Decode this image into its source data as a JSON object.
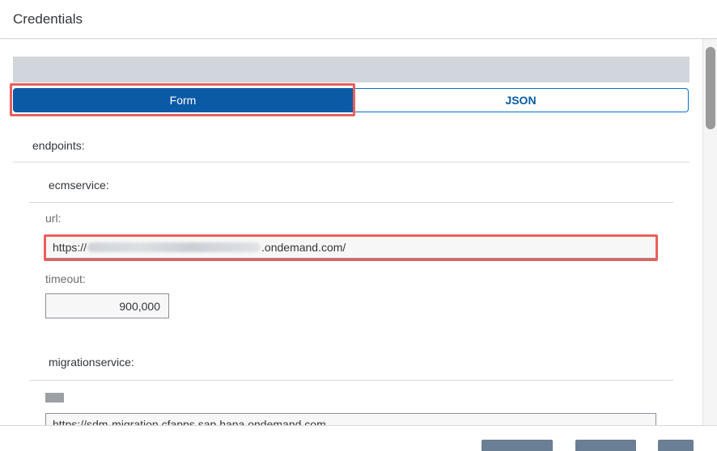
{
  "header": {
    "title": "Credentials"
  },
  "toggle": {
    "form_label": "Form",
    "json_label": "JSON",
    "selected": "Form"
  },
  "form": {
    "endpoints_label": "endpoints:",
    "ecm": {
      "label": "ecmservice:",
      "url_label": "url:",
      "url_prefix": "https://",
      "url_suffix": ".ondemand.com/",
      "timeout_label": "timeout:",
      "timeout_value": "900,000"
    },
    "migration": {
      "label": "migrationservice:",
      "url_value": "https://sdm-migration.cfapps.sap.hana.ondemand.com"
    }
  },
  "colors": {
    "accent": "#0b5aa6",
    "highlight": "#e8605c",
    "footer_button": "#6a7e94"
  }
}
